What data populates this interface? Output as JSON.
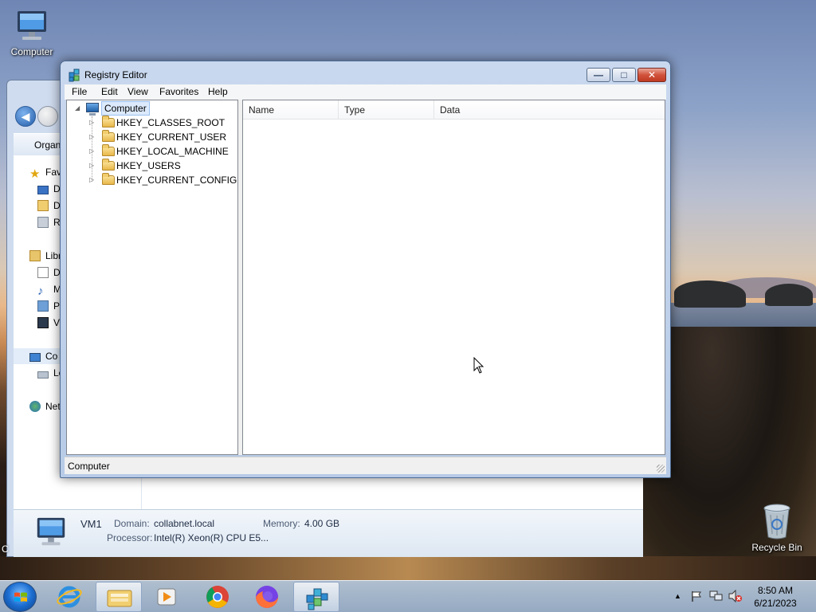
{
  "desktop": {
    "computer_label": "Computer",
    "recycle_label": "Recycle Bin"
  },
  "explorer": {
    "toolbar_organize": "Organiz",
    "sidebar": {
      "favorites": "Fav",
      "fav_items": [
        "D",
        "D",
        "R"
      ],
      "libraries": "Libr",
      "lib_items": [
        "D",
        "M",
        "P",
        "V"
      ],
      "computer": "Co",
      "computer_sub": "Lo",
      "network": "Net"
    },
    "details": {
      "name": "VM1",
      "domain_label": "Domain:",
      "domain_value": "collabnet.local",
      "memory_label": "Memory:",
      "memory_value": "4.00 GB",
      "processor_label": "Processor:",
      "processor_value": "Intel(R) Xeon(R) CPU E5..."
    },
    "left_edge_label": "C"
  },
  "regedit": {
    "title": "Registry Editor",
    "menu": [
      "File",
      "Edit",
      "View",
      "Favorites",
      "Help"
    ],
    "tree_root": "Computer",
    "tree_keys": [
      "HKEY_CLASSES_ROOT",
      "HKEY_CURRENT_USER",
      "HKEY_LOCAL_MACHINE",
      "HKEY_USERS",
      "HKEY_CURRENT_CONFIG"
    ],
    "columns": [
      "Name",
      "Type",
      "Data"
    ],
    "status": "Computer"
  },
  "taskbar": {
    "time": "8:50 AM",
    "date": "6/21/2023",
    "apps": [
      "internet-explorer",
      "file-explorer",
      "media-player",
      "chrome",
      "firefox",
      "registry-editor"
    ]
  }
}
